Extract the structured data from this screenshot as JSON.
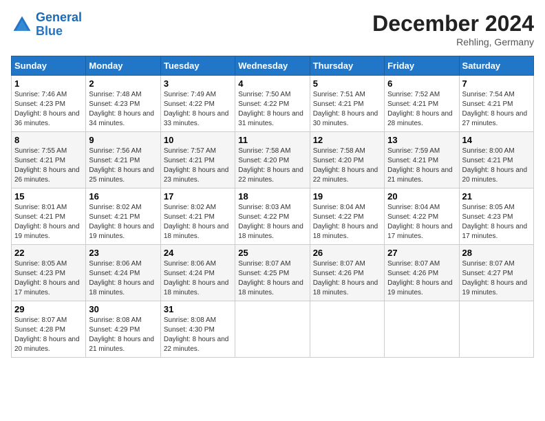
{
  "header": {
    "logo_line1": "General",
    "logo_line2": "Blue",
    "month": "December 2024",
    "location": "Rehling, Germany"
  },
  "columns": [
    "Sunday",
    "Monday",
    "Tuesday",
    "Wednesday",
    "Thursday",
    "Friday",
    "Saturday"
  ],
  "weeks": [
    [
      {
        "day": "1",
        "sunrise": "7:46 AM",
        "sunset": "4:23 PM",
        "daylight": "8 hours and 36 minutes."
      },
      {
        "day": "2",
        "sunrise": "7:48 AM",
        "sunset": "4:23 PM",
        "daylight": "8 hours and 34 minutes."
      },
      {
        "day": "3",
        "sunrise": "7:49 AM",
        "sunset": "4:22 PM",
        "daylight": "8 hours and 33 minutes."
      },
      {
        "day": "4",
        "sunrise": "7:50 AM",
        "sunset": "4:22 PM",
        "daylight": "8 hours and 31 minutes."
      },
      {
        "day": "5",
        "sunrise": "7:51 AM",
        "sunset": "4:21 PM",
        "daylight": "8 hours and 30 minutes."
      },
      {
        "day": "6",
        "sunrise": "7:52 AM",
        "sunset": "4:21 PM",
        "daylight": "8 hours and 28 minutes."
      },
      {
        "day": "7",
        "sunrise": "7:54 AM",
        "sunset": "4:21 PM",
        "daylight": "8 hours and 27 minutes."
      }
    ],
    [
      {
        "day": "8",
        "sunrise": "7:55 AM",
        "sunset": "4:21 PM",
        "daylight": "8 hours and 26 minutes."
      },
      {
        "day": "9",
        "sunrise": "7:56 AM",
        "sunset": "4:21 PM",
        "daylight": "8 hours and 25 minutes."
      },
      {
        "day": "10",
        "sunrise": "7:57 AM",
        "sunset": "4:21 PM",
        "daylight": "8 hours and 23 minutes."
      },
      {
        "day": "11",
        "sunrise": "7:58 AM",
        "sunset": "4:20 PM",
        "daylight": "8 hours and 22 minutes."
      },
      {
        "day": "12",
        "sunrise": "7:58 AM",
        "sunset": "4:20 PM",
        "daylight": "8 hours and 22 minutes."
      },
      {
        "day": "13",
        "sunrise": "7:59 AM",
        "sunset": "4:21 PM",
        "daylight": "8 hours and 21 minutes."
      },
      {
        "day": "14",
        "sunrise": "8:00 AM",
        "sunset": "4:21 PM",
        "daylight": "8 hours and 20 minutes."
      }
    ],
    [
      {
        "day": "15",
        "sunrise": "8:01 AM",
        "sunset": "4:21 PM",
        "daylight": "8 hours and 19 minutes."
      },
      {
        "day": "16",
        "sunrise": "8:02 AM",
        "sunset": "4:21 PM",
        "daylight": "8 hours and 19 minutes."
      },
      {
        "day": "17",
        "sunrise": "8:02 AM",
        "sunset": "4:21 PM",
        "daylight": "8 hours and 18 minutes."
      },
      {
        "day": "18",
        "sunrise": "8:03 AM",
        "sunset": "4:22 PM",
        "daylight": "8 hours and 18 minutes."
      },
      {
        "day": "19",
        "sunrise": "8:04 AM",
        "sunset": "4:22 PM",
        "daylight": "8 hours and 18 minutes."
      },
      {
        "day": "20",
        "sunrise": "8:04 AM",
        "sunset": "4:22 PM",
        "daylight": "8 hours and 17 minutes."
      },
      {
        "day": "21",
        "sunrise": "8:05 AM",
        "sunset": "4:23 PM",
        "daylight": "8 hours and 17 minutes."
      }
    ],
    [
      {
        "day": "22",
        "sunrise": "8:05 AM",
        "sunset": "4:23 PM",
        "daylight": "8 hours and 17 minutes."
      },
      {
        "day": "23",
        "sunrise": "8:06 AM",
        "sunset": "4:24 PM",
        "daylight": "8 hours and 18 minutes."
      },
      {
        "day": "24",
        "sunrise": "8:06 AM",
        "sunset": "4:24 PM",
        "daylight": "8 hours and 18 minutes."
      },
      {
        "day": "25",
        "sunrise": "8:07 AM",
        "sunset": "4:25 PM",
        "daylight": "8 hours and 18 minutes."
      },
      {
        "day": "26",
        "sunrise": "8:07 AM",
        "sunset": "4:26 PM",
        "daylight": "8 hours and 18 minutes."
      },
      {
        "day": "27",
        "sunrise": "8:07 AM",
        "sunset": "4:26 PM",
        "daylight": "8 hours and 19 minutes."
      },
      {
        "day": "28",
        "sunrise": "8:07 AM",
        "sunset": "4:27 PM",
        "daylight": "8 hours and 19 minutes."
      }
    ],
    [
      {
        "day": "29",
        "sunrise": "8:07 AM",
        "sunset": "4:28 PM",
        "daylight": "8 hours and 20 minutes."
      },
      {
        "day": "30",
        "sunrise": "8:08 AM",
        "sunset": "4:29 PM",
        "daylight": "8 hours and 21 minutes."
      },
      {
        "day": "31",
        "sunrise": "8:08 AM",
        "sunset": "4:30 PM",
        "daylight": "8 hours and 22 minutes."
      },
      null,
      null,
      null,
      null
    ]
  ]
}
